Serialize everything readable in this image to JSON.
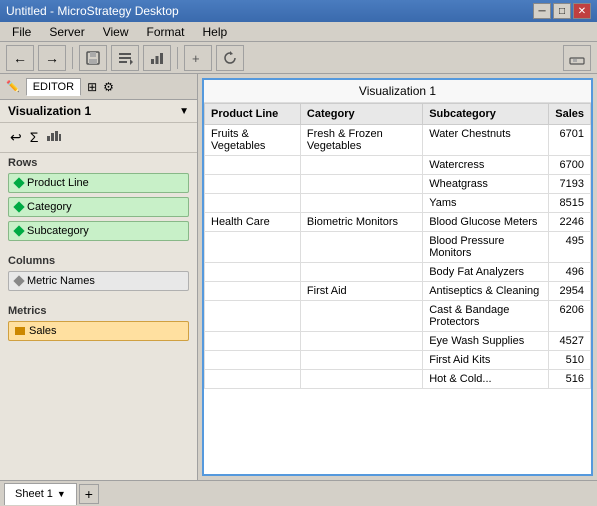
{
  "titleBar": {
    "title": "Untitled - MicroStrategy Desktop",
    "minBtn": "─",
    "maxBtn": "□",
    "closeBtn": "✕"
  },
  "menuBar": {
    "items": [
      "File",
      "Server",
      "View",
      "Format",
      "Help"
    ]
  },
  "toolbar": {
    "buttons": [
      "←",
      "→",
      "💾",
      "≡↓",
      "📊",
      "+▾",
      "↺",
      "📋"
    ]
  },
  "leftPanel": {
    "tab": "EDITOR",
    "vizLabel": "Visualization 1",
    "rowsLabel": "Rows",
    "fields": [
      {
        "id": "product-line",
        "label": "Product Line"
      },
      {
        "id": "category",
        "label": "Category"
      },
      {
        "id": "subcategory",
        "label": "Subcategory"
      }
    ],
    "columnsLabel": "Columns",
    "metricNames": "Metric Names",
    "metricsLabel": "Metrics",
    "salesLabel": "Sales"
  },
  "visualization": {
    "title": "Visualization 1",
    "tableHeaders": [
      "Product Line",
      "Category",
      "Subcategory",
      "Sales"
    ],
    "rows": [
      {
        "productLine": "Fruits & Vegetables",
        "category": "Fresh & Frozen Vegetables",
        "subcategory": "Water Chestnuts",
        "sales": "6701"
      },
      {
        "productLine": "",
        "category": "",
        "subcategory": "Watercress",
        "sales": "6700"
      },
      {
        "productLine": "",
        "category": "",
        "subcategory": "Wheatgrass",
        "sales": "7193"
      },
      {
        "productLine": "",
        "category": "",
        "subcategory": "Yams",
        "sales": "8515"
      },
      {
        "productLine": "Health Care",
        "category": "Biometric Monitors",
        "subcategory": "Blood Glucose Meters",
        "sales": "2246"
      },
      {
        "productLine": "",
        "category": "",
        "subcategory": "Blood Pressure Monitors",
        "sales": "495"
      },
      {
        "productLine": "",
        "category": "",
        "subcategory": "Body Fat Analyzers",
        "sales": "496"
      },
      {
        "productLine": "",
        "category": "First Aid",
        "subcategory": "Antiseptics & Cleaning",
        "sales": "2954"
      },
      {
        "productLine": "",
        "category": "",
        "subcategory": "Cast & Bandage Protectors",
        "sales": "6206"
      },
      {
        "productLine": "",
        "category": "",
        "subcategory": "Eye Wash Supplies",
        "sales": "4527"
      },
      {
        "productLine": "",
        "category": "",
        "subcategory": "First Aid Kits",
        "sales": "510"
      },
      {
        "productLine": "",
        "category": "",
        "subcategory": "Hot & Cold...",
        "sales": "516"
      }
    ]
  },
  "tabBar": {
    "sheets": [
      "Sheet 1"
    ],
    "addLabel": "+"
  }
}
